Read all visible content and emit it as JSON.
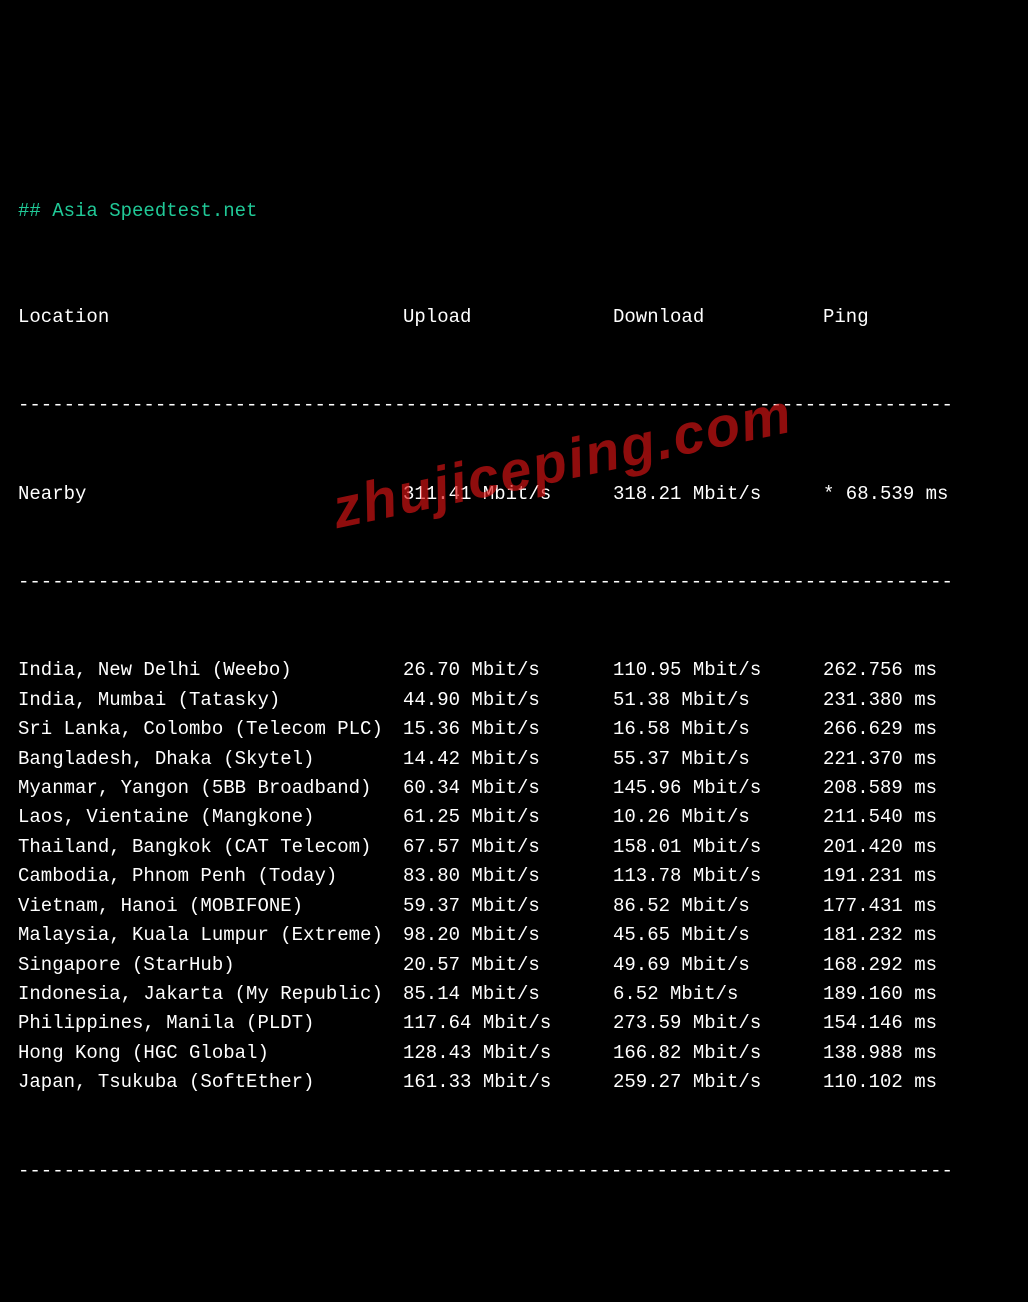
{
  "header": "## Asia Speedtest.net",
  "columns": {
    "location": "Location",
    "upload": "Upload",
    "download": "Download",
    "ping": "Ping"
  },
  "divider": "----------------------------------------------------------------------------------",
  "nearby": {
    "location": "Nearby",
    "upload": "311.41 Mbit/s",
    "download": "318.21 Mbit/s",
    "ping": "* 68.539 ms"
  },
  "rows": [
    {
      "location": "India, New Delhi (Weebo)",
      "upload": "26.70 Mbit/s",
      "download": "110.95 Mbit/s",
      "ping": "262.756 ms"
    },
    {
      "location": "India, Mumbai (Tatasky)",
      "upload": "44.90 Mbit/s",
      "download": "51.38 Mbit/s",
      "ping": "231.380 ms"
    },
    {
      "location": "Sri Lanka, Colombo (Telecom PLC)",
      "upload": "15.36 Mbit/s",
      "download": "16.58 Mbit/s",
      "ping": "266.629 ms"
    },
    {
      "location": "Bangladesh, Dhaka (Skytel)",
      "upload": "14.42 Mbit/s",
      "download": "55.37 Mbit/s",
      "ping": "221.370 ms"
    },
    {
      "location": "Myanmar, Yangon (5BB Broadband)",
      "upload": "60.34 Mbit/s",
      "download": "145.96 Mbit/s",
      "ping": "208.589 ms"
    },
    {
      "location": "Laos, Vientaine (Mangkone)",
      "upload": "61.25 Mbit/s",
      "download": "10.26 Mbit/s",
      "ping": "211.540 ms"
    },
    {
      "location": "Thailand, Bangkok (CAT Telecom)",
      "upload": "67.57 Mbit/s",
      "download": "158.01 Mbit/s",
      "ping": "201.420 ms"
    },
    {
      "location": "Cambodia, Phnom Penh (Today)",
      "upload": "83.80 Mbit/s",
      "download": "113.78 Mbit/s",
      "ping": "191.231 ms"
    },
    {
      "location": "Vietnam, Hanoi (MOBIFONE)",
      "upload": "59.37 Mbit/s",
      "download": "86.52 Mbit/s",
      "ping": "177.431 ms"
    },
    {
      "location": "Malaysia, Kuala Lumpur (Extreme)",
      "upload": "98.20 Mbit/s",
      "download": "45.65 Mbit/s",
      "ping": "181.232 ms"
    },
    {
      "location": "Singapore (StarHub)",
      "upload": "20.57 Mbit/s",
      "download": "49.69 Mbit/s",
      "ping": "168.292 ms"
    },
    {
      "location": "Indonesia, Jakarta (My Republic)",
      "upload": "85.14 Mbit/s",
      "download": "6.52 Mbit/s",
      "ping": "189.160 ms"
    },
    {
      "location": "Philippines, Manila (PLDT)",
      "upload": "117.64 Mbit/s",
      "download": "273.59 Mbit/s",
      "ping": "154.146 ms"
    },
    {
      "location": "Hong Kong (HGC Global)",
      "upload": "128.43 Mbit/s",
      "download": "166.82 Mbit/s",
      "ping": "138.988 ms"
    },
    {
      "location": "Japan, Tsukuba (SoftEther)",
      "upload": "161.33 Mbit/s",
      "download": "259.27 Mbit/s",
      "ping": "110.102 ms"
    }
  ],
  "watermark": "zhujiceping.com"
}
